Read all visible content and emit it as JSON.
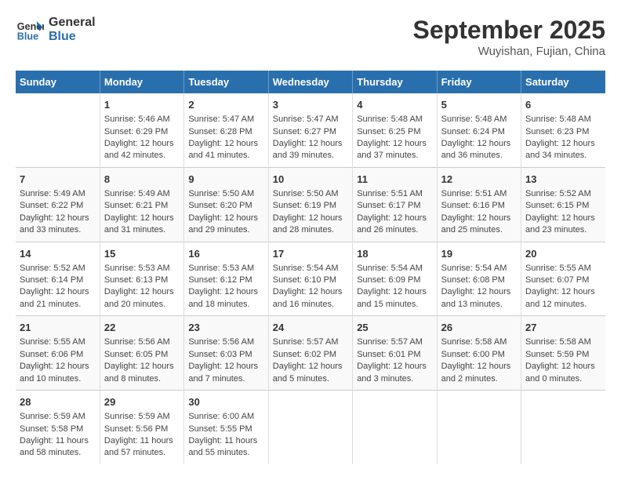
{
  "header": {
    "logo_line1": "General",
    "logo_line2": "Blue",
    "month_title": "September 2025",
    "location": "Wuyishan, Fujian, China"
  },
  "days_of_week": [
    "Sunday",
    "Monday",
    "Tuesday",
    "Wednesday",
    "Thursday",
    "Friday",
    "Saturday"
  ],
  "weeks": [
    [
      {
        "num": "",
        "info": ""
      },
      {
        "num": "1",
        "info": "Sunrise: 5:46 AM\nSunset: 6:29 PM\nDaylight: 12 hours\nand 42 minutes."
      },
      {
        "num": "2",
        "info": "Sunrise: 5:47 AM\nSunset: 6:28 PM\nDaylight: 12 hours\nand 41 minutes."
      },
      {
        "num": "3",
        "info": "Sunrise: 5:47 AM\nSunset: 6:27 PM\nDaylight: 12 hours\nand 39 minutes."
      },
      {
        "num": "4",
        "info": "Sunrise: 5:48 AM\nSunset: 6:25 PM\nDaylight: 12 hours\nand 37 minutes."
      },
      {
        "num": "5",
        "info": "Sunrise: 5:48 AM\nSunset: 6:24 PM\nDaylight: 12 hours\nand 36 minutes."
      },
      {
        "num": "6",
        "info": "Sunrise: 5:48 AM\nSunset: 6:23 PM\nDaylight: 12 hours\nand 34 minutes."
      }
    ],
    [
      {
        "num": "7",
        "info": "Sunrise: 5:49 AM\nSunset: 6:22 PM\nDaylight: 12 hours\nand 33 minutes."
      },
      {
        "num": "8",
        "info": "Sunrise: 5:49 AM\nSunset: 6:21 PM\nDaylight: 12 hours\nand 31 minutes."
      },
      {
        "num": "9",
        "info": "Sunrise: 5:50 AM\nSunset: 6:20 PM\nDaylight: 12 hours\nand 29 minutes."
      },
      {
        "num": "10",
        "info": "Sunrise: 5:50 AM\nSunset: 6:19 PM\nDaylight: 12 hours\nand 28 minutes."
      },
      {
        "num": "11",
        "info": "Sunrise: 5:51 AM\nSunset: 6:17 PM\nDaylight: 12 hours\nand 26 minutes."
      },
      {
        "num": "12",
        "info": "Sunrise: 5:51 AM\nSunset: 6:16 PM\nDaylight: 12 hours\nand 25 minutes."
      },
      {
        "num": "13",
        "info": "Sunrise: 5:52 AM\nSunset: 6:15 PM\nDaylight: 12 hours\nand 23 minutes."
      }
    ],
    [
      {
        "num": "14",
        "info": "Sunrise: 5:52 AM\nSunset: 6:14 PM\nDaylight: 12 hours\nand 21 minutes."
      },
      {
        "num": "15",
        "info": "Sunrise: 5:53 AM\nSunset: 6:13 PM\nDaylight: 12 hours\nand 20 minutes."
      },
      {
        "num": "16",
        "info": "Sunrise: 5:53 AM\nSunset: 6:12 PM\nDaylight: 12 hours\nand 18 minutes."
      },
      {
        "num": "17",
        "info": "Sunrise: 5:54 AM\nSunset: 6:10 PM\nDaylight: 12 hours\nand 16 minutes."
      },
      {
        "num": "18",
        "info": "Sunrise: 5:54 AM\nSunset: 6:09 PM\nDaylight: 12 hours\nand 15 minutes."
      },
      {
        "num": "19",
        "info": "Sunrise: 5:54 AM\nSunset: 6:08 PM\nDaylight: 12 hours\nand 13 minutes."
      },
      {
        "num": "20",
        "info": "Sunrise: 5:55 AM\nSunset: 6:07 PM\nDaylight: 12 hours\nand 12 minutes."
      }
    ],
    [
      {
        "num": "21",
        "info": "Sunrise: 5:55 AM\nSunset: 6:06 PM\nDaylight: 12 hours\nand 10 minutes."
      },
      {
        "num": "22",
        "info": "Sunrise: 5:56 AM\nSunset: 6:05 PM\nDaylight: 12 hours\nand 8 minutes."
      },
      {
        "num": "23",
        "info": "Sunrise: 5:56 AM\nSunset: 6:03 PM\nDaylight: 12 hours\nand 7 minutes."
      },
      {
        "num": "24",
        "info": "Sunrise: 5:57 AM\nSunset: 6:02 PM\nDaylight: 12 hours\nand 5 minutes."
      },
      {
        "num": "25",
        "info": "Sunrise: 5:57 AM\nSunset: 6:01 PM\nDaylight: 12 hours\nand 3 minutes."
      },
      {
        "num": "26",
        "info": "Sunrise: 5:58 AM\nSunset: 6:00 PM\nDaylight: 12 hours\nand 2 minutes."
      },
      {
        "num": "27",
        "info": "Sunrise: 5:58 AM\nSunset: 5:59 PM\nDaylight: 12 hours\nand 0 minutes."
      }
    ],
    [
      {
        "num": "28",
        "info": "Sunrise: 5:59 AM\nSunset: 5:58 PM\nDaylight: 11 hours\nand 58 minutes."
      },
      {
        "num": "29",
        "info": "Sunrise: 5:59 AM\nSunset: 5:56 PM\nDaylight: 11 hours\nand 57 minutes."
      },
      {
        "num": "30",
        "info": "Sunrise: 6:00 AM\nSunset: 5:55 PM\nDaylight: 11 hours\nand 55 minutes."
      },
      {
        "num": "",
        "info": ""
      },
      {
        "num": "",
        "info": ""
      },
      {
        "num": "",
        "info": ""
      },
      {
        "num": "",
        "info": ""
      }
    ]
  ]
}
